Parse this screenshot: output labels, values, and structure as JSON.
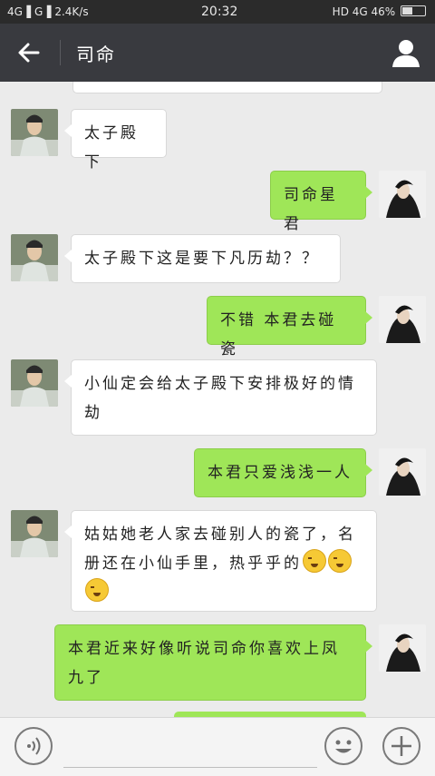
{
  "status_bar": {
    "left": "4G▐ G▐ 2.4K/s",
    "time": "20:32",
    "right": "HD 4G 46%",
    "battery_level": 0.46
  },
  "header": {
    "title": "司命",
    "back_icon": "arrow-left-icon",
    "profile_icon": "person-icon"
  },
  "messages": [
    {
      "side": "in",
      "text": "太子殿下"
    },
    {
      "side": "out",
      "text": "司命星君"
    },
    {
      "side": "in",
      "text": "太子殿下这是要下凡历劫？？"
    },
    {
      "side": "out",
      "text": "不错 本君去碰瓷"
    },
    {
      "side": "in",
      "text": "小仙定会给太子殿下安排极好的情劫"
    },
    {
      "side": "out",
      "text": "本君只爱浅浅一人"
    },
    {
      "side": "in",
      "text": "姑姑她老人家去碰别人的瓷了，名册还在小仙手里，热乎乎的"
    },
    {
      "side": "out",
      "text": "本君近来好像听说司命你喜欢上凤九了"
    }
  ],
  "input_bar": {
    "voice_icon": "voice-icon",
    "emoji_icon": "smiley-icon",
    "plus_icon": "plus-icon"
  },
  "colors": {
    "header_bg": "#393a3f",
    "chat_bg": "#ebebeb",
    "bubble_out": "#9fe658",
    "bubble_in": "#ffffff"
  }
}
